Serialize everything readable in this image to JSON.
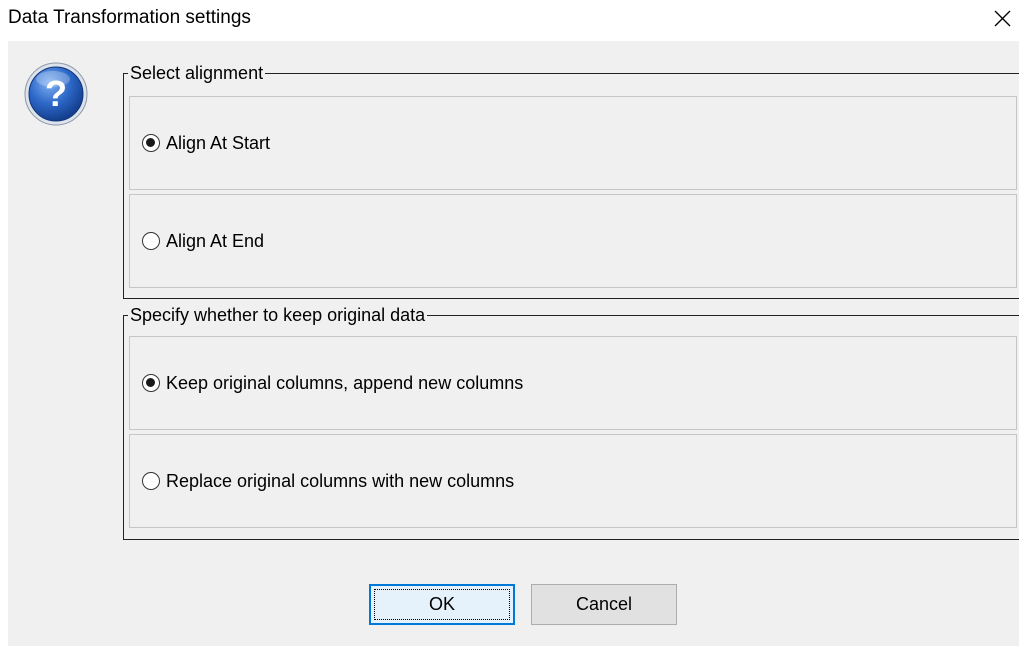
{
  "window": {
    "title": "Data Transformation settings",
    "close_icon": "close-icon"
  },
  "help_icon": {
    "name": "question-icon",
    "glyph": "?",
    "color": "#1c57b8"
  },
  "alignment_group": {
    "legend": "Select alignment",
    "options": [
      {
        "label": "Align At Start",
        "checked": true
      },
      {
        "label": "Align At End",
        "checked": false
      }
    ]
  },
  "keep_data_group": {
    "legend": "Specify whether to keep original data",
    "options": [
      {
        "label": "Keep original columns, append new columns",
        "checked": true
      },
      {
        "label": "Replace original columns with new columns",
        "checked": false
      }
    ]
  },
  "buttons": {
    "ok_label": "OK",
    "cancel_label": "Cancel"
  },
  "colors": {
    "dialog_background": "#f0f0f0",
    "focus_border": "#0078d7",
    "icon_blue": "#1c57b8"
  }
}
